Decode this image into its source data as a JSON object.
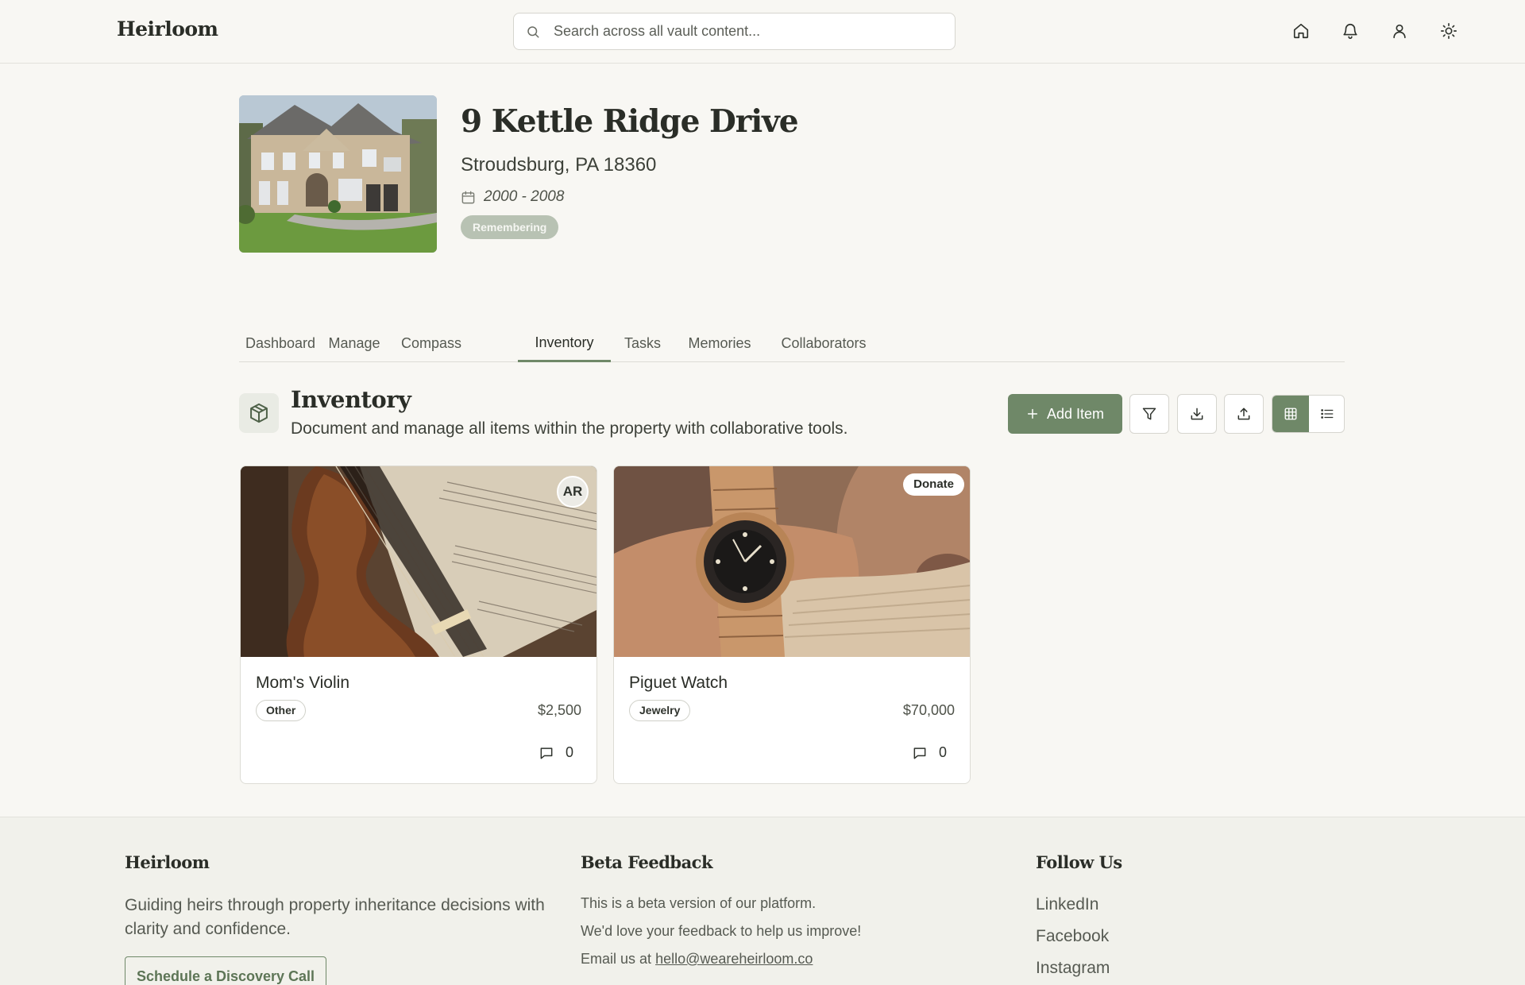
{
  "header": {
    "brand": "Heirloom",
    "search_placeholder": "Search across all vault content...",
    "icons": [
      "home-icon",
      "bell-icon",
      "user-icon",
      "sun-icon"
    ]
  },
  "property": {
    "title": "9 Kettle Ridge Drive",
    "address": "Stroudsburg, PA 18360",
    "dates": "2000 - 2008",
    "status": "Remembering"
  },
  "tabs": [
    {
      "label": "Dashboard"
    },
    {
      "label": "Manage"
    },
    {
      "label": "Compass"
    },
    {
      "label": "Inventory",
      "active": true
    },
    {
      "label": "Tasks"
    },
    {
      "label": "Memories"
    },
    {
      "label": "Collaborators"
    }
  ],
  "section": {
    "title": "Inventory",
    "description": "Document and manage all items within the property with collaborative tools.",
    "add_label": "Add Item"
  },
  "items": [
    {
      "title": "Mom's Violin",
      "category": "Other",
      "price": "$2,500",
      "comments": "0",
      "avatar": "AR"
    },
    {
      "title": "Piguet Watch",
      "category": "Jewelry",
      "price": "$70,000",
      "comments": "0",
      "badge": "Donate"
    }
  ],
  "footer": {
    "brand": "Heirloom",
    "tagline": "Guiding heirs through property inheritance decisions with clarity and confidence.",
    "cta": "Schedule a Discovery Call",
    "beta_title": "Beta Feedback",
    "beta_line1": "This is a beta version of our platform.",
    "beta_line2": "We'd love your feedback to help us improve!",
    "beta_email_prefix": "Email us at",
    "beta_email": "hello@weareheirloom.co",
    "follow_title": "Follow Us",
    "social": [
      "LinkedIn",
      "Facebook",
      "Instagram"
    ]
  },
  "colors": {
    "accent": "#6f8868",
    "background": "#f8f7f3",
    "footer_bg": "#f1f1eb"
  }
}
